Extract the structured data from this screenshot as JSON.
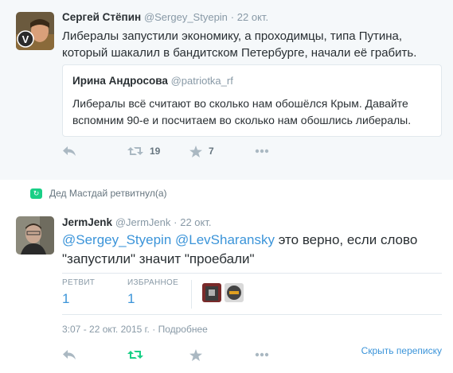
{
  "tweet1": {
    "fullname": "Сергей Стёпин",
    "handle": "@Sergey_Styepin",
    "dot": "·",
    "time": "22 окт.",
    "text": "Либералы запустили экономику, а проходимцы, типа Путина, который шакалил в бандитском Петербурге, начали её грабить.",
    "quote": {
      "fullname": "Ирина Андросова",
      "handle": "@patriotka_rf",
      "text": "Либералы всё считают во сколько нам обошёлся Крым. Давайте вспомним 90-е и посчитаем во сколько нам обошлись либералы."
    },
    "retweet_count": "19",
    "favorite_count": "7"
  },
  "retweet_notice": "Дед Мастдай ретвитнул(а)",
  "tweet2": {
    "fullname": "JermJenk",
    "handle": "@JermJenk",
    "dot": "·",
    "time": "22 окт.",
    "mention1": "@Sergey_Styepin",
    "mention2": "@LevSharansky",
    "text_part1": " это верно, если слово",
    "text_part2": "\"запустили\" значит \"проебали\"",
    "retweets_label": "РЕТВИТ",
    "retweets_value": "1",
    "favorites_label": "ИЗБРАННОЕ",
    "favorites_value": "1",
    "timestamp": "3:07 - 22 окт. 2015 г.",
    "details_dot": "·",
    "details_link": "Подробнее",
    "hide_conversation": "Скрыть переписку"
  },
  "colors": {
    "link": "#3b94d9",
    "retweet_green": "#19cf86",
    "icon_gray": "#aab8c2",
    "bg_highlight": "#f5f8fa"
  },
  "icons": [
    "reply-icon",
    "retweet-icon",
    "star-icon",
    "more-icon"
  ]
}
